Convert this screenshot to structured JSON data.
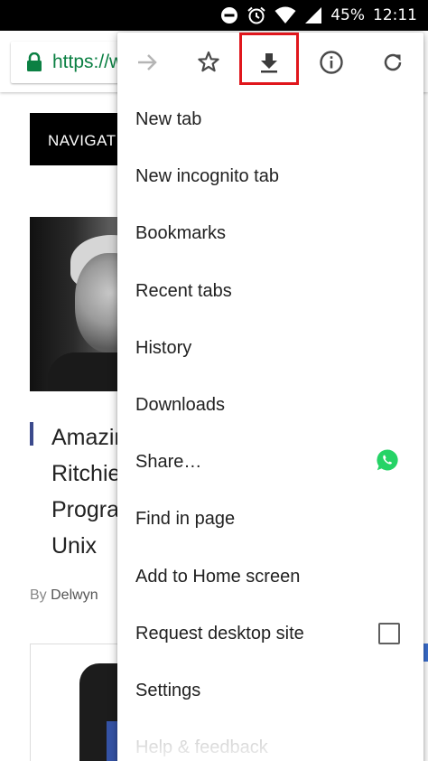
{
  "status_bar": {
    "battery": "45%",
    "time": "12:11"
  },
  "toolbar": {
    "url_partial": "https://w"
  },
  "page": {
    "nav_label": "NAVIGATION",
    "article_title": "Amazing\nRitchie\nProgra\nUnix",
    "byline_prefix": "By",
    "byline_author": "Delwyn"
  },
  "menu": {
    "icons": [
      "forward-icon",
      "bookmark-star-icon",
      "download-icon",
      "info-icon",
      "refresh-icon"
    ],
    "items": [
      {
        "label": "New tab"
      },
      {
        "label": "New incognito tab"
      },
      {
        "label": "Bookmarks"
      },
      {
        "label": "Recent tabs"
      },
      {
        "label": "History"
      },
      {
        "label": "Downloads"
      },
      {
        "label": "Share…",
        "icon": "whatsapp-icon"
      },
      {
        "label": "Find in page"
      },
      {
        "label": "Add to Home screen"
      },
      {
        "label": "Request desktop site",
        "checked": false
      },
      {
        "label": "Settings"
      },
      {
        "label": "Help & feedback"
      }
    ]
  },
  "colors": {
    "highlight": "#e0161c",
    "secure_url": "#0b8043",
    "whatsapp": "#25d366",
    "title_accent": "#3b4a8c"
  }
}
